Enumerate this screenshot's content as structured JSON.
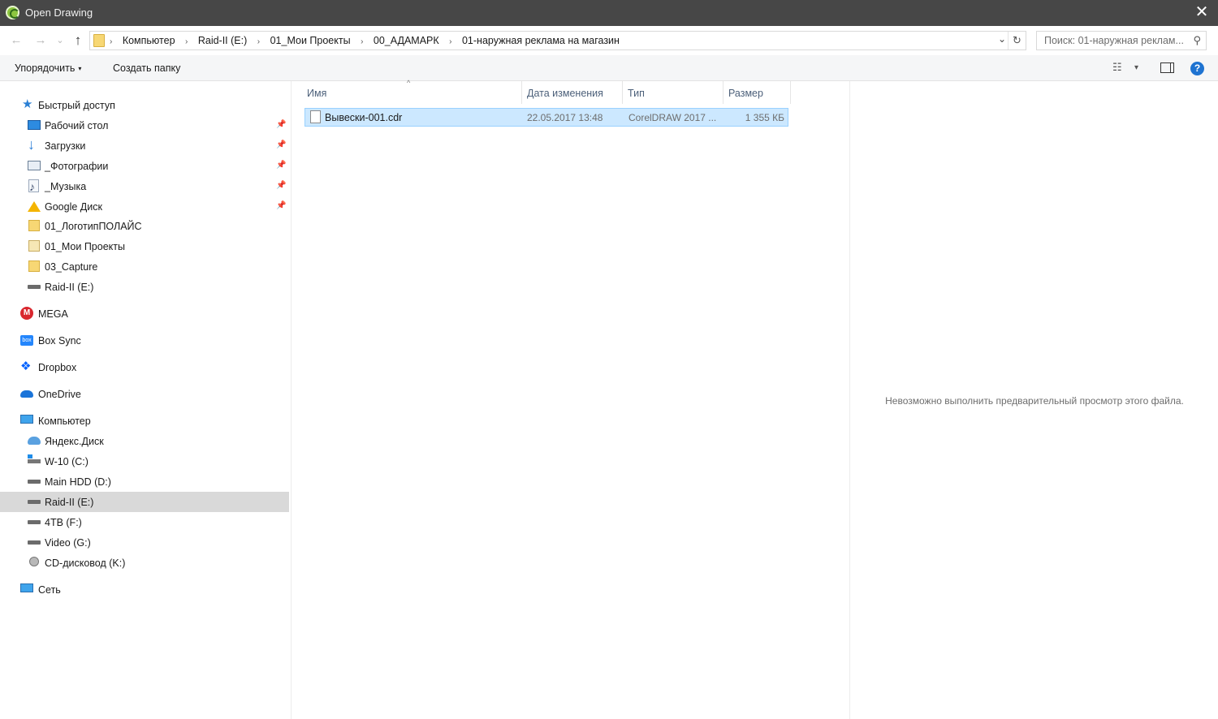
{
  "window": {
    "title": "Open Drawing",
    "close_icon": "✕"
  },
  "navigation": {
    "back_icon": "←",
    "forward_icon": "→",
    "recent_icon": "⌄",
    "up_icon": "↑",
    "breadcrumbs": [
      "Компьютер",
      "Raid-II (E:)",
      "01_Мои Проекты",
      "00_АДАМАРК",
      "01-наружная реклама на магазин"
    ],
    "separator": "›",
    "dropdown_icon": "⌄",
    "refresh_icon": "↻",
    "search_placeholder": "Поиск: 01-наружная реклам...",
    "search_icon": "⚲"
  },
  "toolbar": {
    "organize_label": "Упорядочить",
    "new_folder_label": "Создать папку",
    "view_icon": "☷",
    "view_caret": "▾",
    "help_label": "?"
  },
  "sidebar": {
    "pin_icon": "📌",
    "items": [
      {
        "label": "Быстрый доступ",
        "icon": "star-icon",
        "pinned": false
      },
      {
        "label": "Рабочий стол",
        "icon": "desktop-icon",
        "pinned": true
      },
      {
        "label": "Загрузки",
        "icon": "downloads-icon",
        "pinned": true
      },
      {
        "label": "_Фотографии",
        "icon": "pictures-icon",
        "pinned": true
      },
      {
        "label": "_Музыка",
        "icon": "music-icon",
        "pinned": true
      },
      {
        "label": "Google Диск",
        "icon": "google-drive-icon",
        "pinned": true
      },
      {
        "label": "01_ЛоготипПОЛАЙС",
        "icon": "folder-icon",
        "pinned": false
      },
      {
        "label": "01_Мои Проекты",
        "icon": "folder-icon",
        "pinned": false
      },
      {
        "label": "03_Capture",
        "icon": "folder-icon",
        "pinned": false
      },
      {
        "label": "Raid-II (E:)",
        "icon": "drive-icon",
        "pinned": false
      },
      {
        "label": "MEGA",
        "icon": "mega-icon",
        "pinned": false
      },
      {
        "label": "Box Sync",
        "icon": "box-icon",
        "pinned": false
      },
      {
        "label": "Dropbox",
        "icon": "dropbox-icon",
        "pinned": false
      },
      {
        "label": "OneDrive",
        "icon": "onedrive-icon",
        "pinned": false
      },
      {
        "label": "Компьютер",
        "icon": "computer-icon",
        "pinned": false
      },
      {
        "label": "Яндекс.Диск",
        "icon": "yandex-disk-icon",
        "pinned": false
      },
      {
        "label": "W-10 (C:)",
        "icon": "windows-drive-icon",
        "pinned": false
      },
      {
        "label": "Main HDD (D:)",
        "icon": "drive-icon",
        "pinned": false
      },
      {
        "label": "Raid-II (E:)",
        "icon": "drive-icon",
        "pinned": false,
        "selected": true
      },
      {
        "label": "4TB (F:)",
        "icon": "drive-icon",
        "pinned": false
      },
      {
        "label": "Video (G:)",
        "icon": "drive-icon",
        "pinned": false
      },
      {
        "label": "CD-дисковод (K:)",
        "icon": "cd-drive-icon",
        "pinned": false
      },
      {
        "label": "Сеть",
        "icon": "network-icon",
        "pinned": false
      }
    ]
  },
  "file_list": {
    "sort_icon": "^",
    "columns": [
      "Имя",
      "Дата изменения",
      "Тип",
      "Размер"
    ],
    "rows": [
      {
        "name": "Вывески-001.cdr",
        "date": "22.05.2017 13:48",
        "type": "CorelDRAW 2017 ...",
        "size": "1 355 КБ"
      }
    ]
  },
  "preview": {
    "message": "Невозможно выполнить предварительный просмотр этого файла."
  }
}
